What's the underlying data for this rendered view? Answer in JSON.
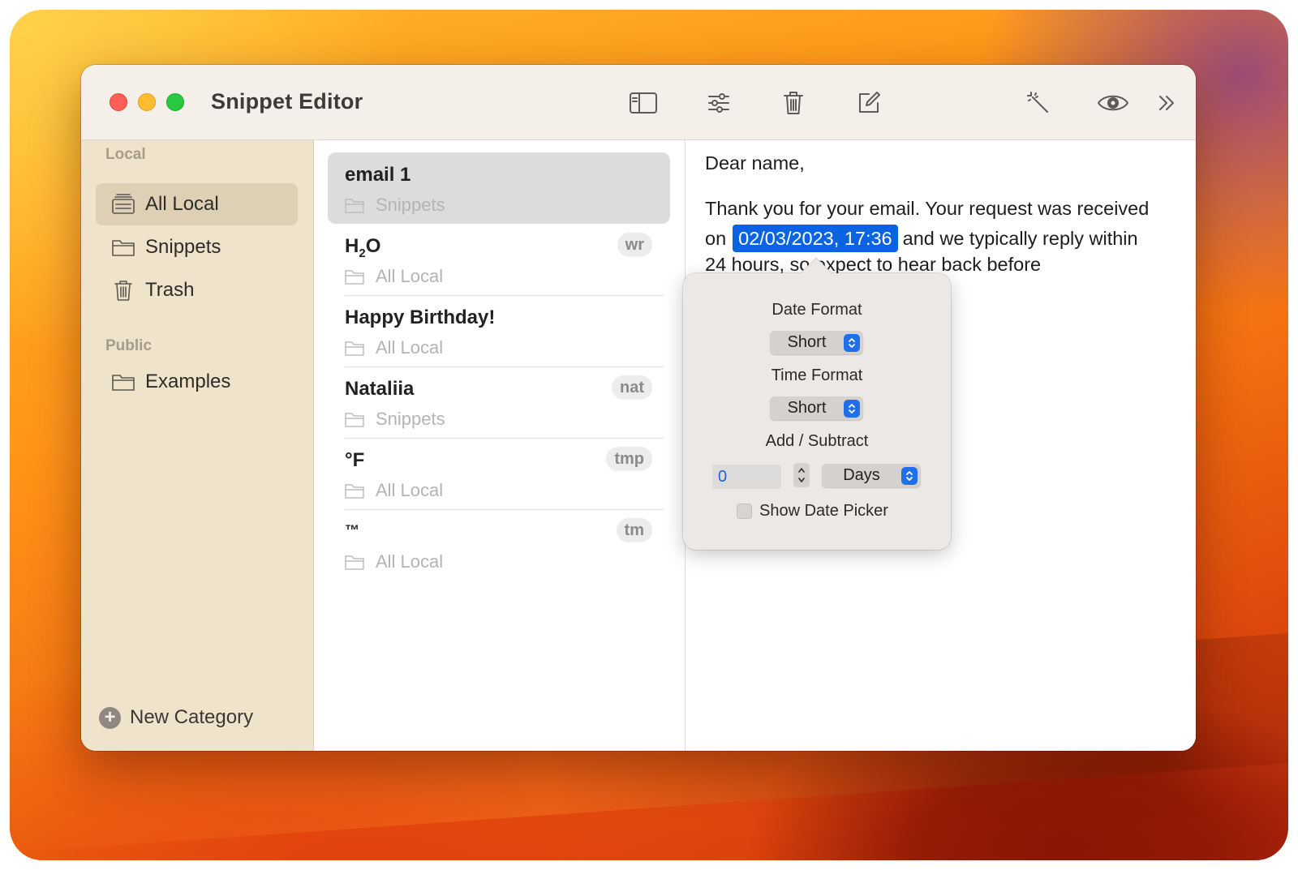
{
  "window": {
    "title": "Snippet Editor"
  },
  "toolbar": {
    "icons": [
      "sidebar-toggle-icon",
      "sliders-icon",
      "trash-icon",
      "compose-icon",
      "magic-wand-icon",
      "eye-icon",
      "chevron-double-right-icon"
    ]
  },
  "sidebar": {
    "local_header": "Local",
    "local_items": [
      {
        "label": "All Local",
        "icon": "tray-stack-icon",
        "selected": true
      },
      {
        "label": "Snippets",
        "icon": "folder-icon"
      },
      {
        "label": "Trash",
        "icon": "trash-icon"
      }
    ],
    "public_header": "Public",
    "public_items": [
      {
        "label": "Examples",
        "icon": "folder-icon"
      }
    ],
    "new_category": "New Category"
  },
  "snippets": [
    {
      "title": "email 1",
      "category": "Snippets",
      "tag": "",
      "selected": true
    },
    {
      "title_main": "H",
      "title_sub": "2",
      "title_rest": "O",
      "category": "All Local",
      "tag": "wr"
    },
    {
      "title": "Happy Birthday!",
      "category": "All Local",
      "tag": ""
    },
    {
      "title": "Nataliia",
      "category": "Snippets",
      "tag": "nat"
    },
    {
      "title": "°F",
      "category": "All Local",
      "tag": "tmp"
    },
    {
      "title": "™",
      "category": "All Local",
      "tag": "tm"
    }
  ],
  "editor": {
    "line1": "Dear name,",
    "line2": "Thank you for your email. Your request was received",
    "line3_pre": "on",
    "date_token": "02/03/2023, 17:36",
    "line3_post": "and we typically reply within",
    "line4": "24 hours, so expect to hear back before"
  },
  "popover": {
    "date_format_label": "Date Format",
    "date_format_value": "Short",
    "time_format_label": "Time Format",
    "time_format_value": "Short",
    "add_subtract_label": "Add / Subtract",
    "amount_value": "0",
    "unit_value": "Days",
    "show_date_picker_label": "Show Date Picker",
    "show_date_picker_checked": false
  },
  "colors": {
    "accent": "#0a64e1",
    "sidebar_bg": "#efe3cb",
    "selected_row": "#dcdcdc"
  }
}
